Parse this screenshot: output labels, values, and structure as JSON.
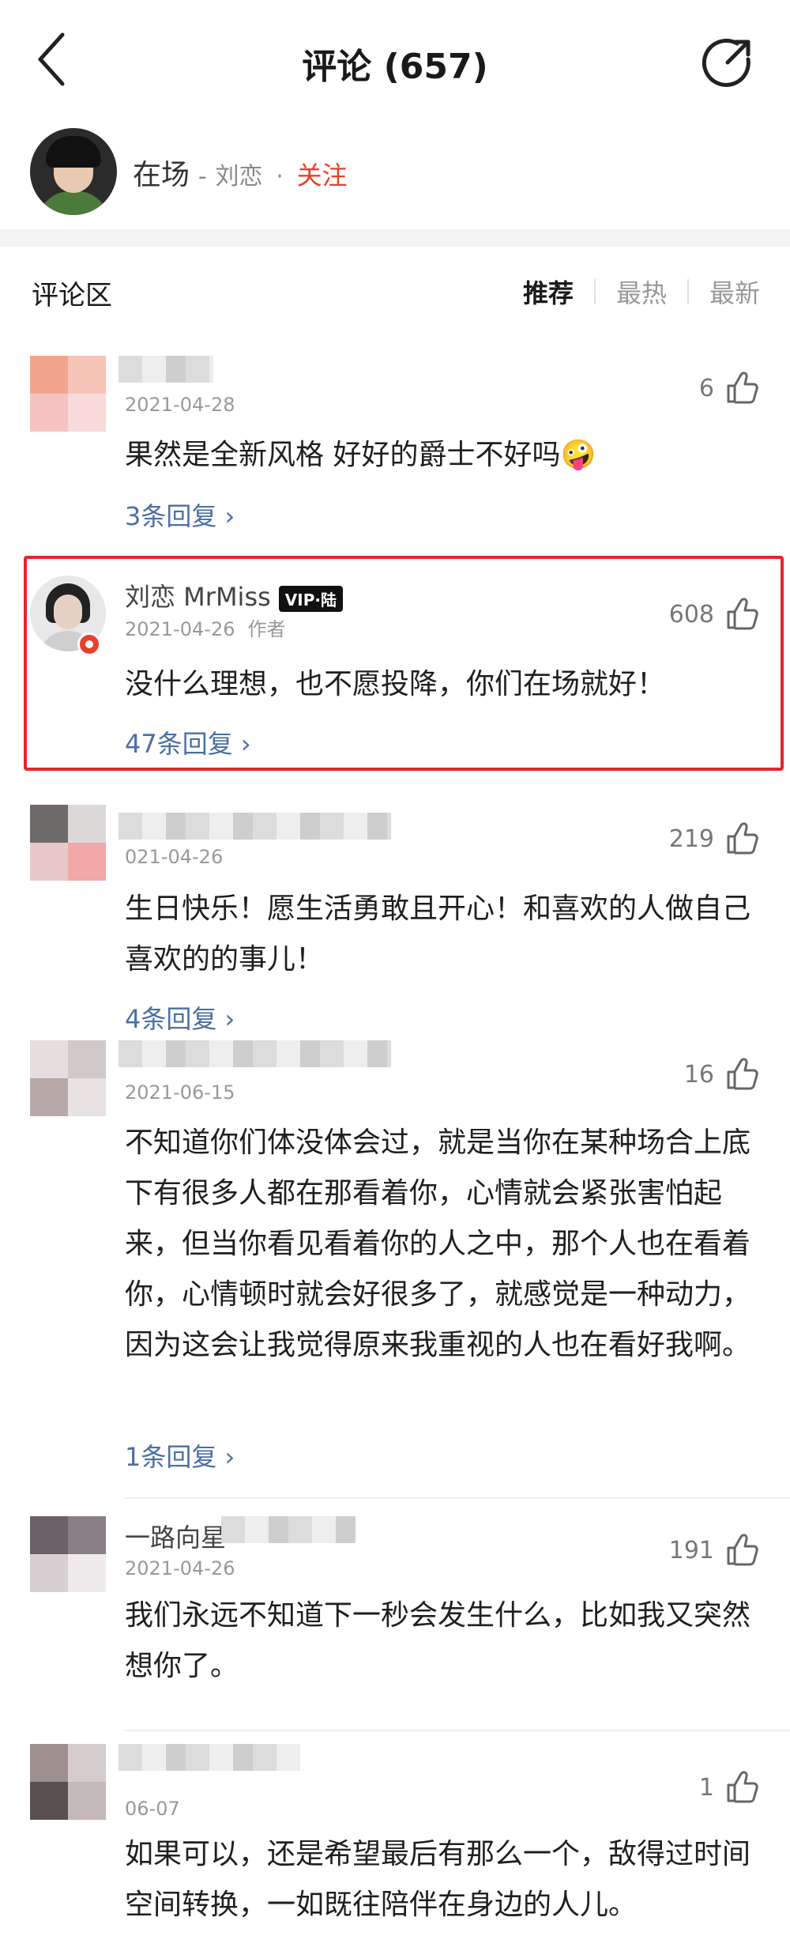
{
  "header": {
    "title": "评论 (657)"
  },
  "author_bar": {
    "song": "在场",
    "dash": "-",
    "singer": "刘恋",
    "dot": "·",
    "follow_label": "关注"
  },
  "section": {
    "title": "评论区",
    "tabs": [
      "推荐",
      "最热",
      "最新"
    ]
  },
  "comments": [
    {
      "name": "",
      "date": "2021-04-28",
      "likes": "6",
      "text": "果然是全新风格 好好的爵士不好吗🤪",
      "replies": "3条回复 ›"
    },
    {
      "name": "刘恋 MrMiss",
      "badge": "VIP·陆",
      "date": "2021-04-26",
      "author_tag": "作者",
      "likes": "608",
      "text": "没什么理想，也不愿投降，你们在场就好！",
      "replies": "47条回复 ›"
    },
    {
      "name": "",
      "date": "021-04-26",
      "likes": "219",
      "text": "生日快乐！愿生活勇敢且开心！和喜欢的人做自己喜欢的的事儿！",
      "replies": "4条回复 ›"
    },
    {
      "name": "",
      "date": "2021-06-15",
      "likes": "16",
      "text": "不知道你们体没体会过，就是当你在某种场合上底下有很多人都在那看着你，心情就会紧张害怕起来，但当你看见看着你的人之中，那个人也在看着你，心情顿时就会好很多了，就感觉是一种动力，因为这会让我觉得原来我重视的人也在看好我啊。",
      "replies": "1条回复 ›"
    },
    {
      "name": "一路向星",
      "date": "2021-04-26",
      "likes": "191",
      "text": "我们永远不知道下一秒会发生什么，比如我又突然想你了。",
      "replies": ""
    },
    {
      "name": "",
      "date": "06-07",
      "likes": "1",
      "text": "如果可以，还是希望最后有那么一个，敌得过时间空间转换，一如既往陪伴在身边的人儿。",
      "replies": ""
    }
  ],
  "colors": {
    "accent_red": "#e8402c",
    "highlight_border": "#e8232e",
    "reply_link": "#4a6fa5"
  }
}
